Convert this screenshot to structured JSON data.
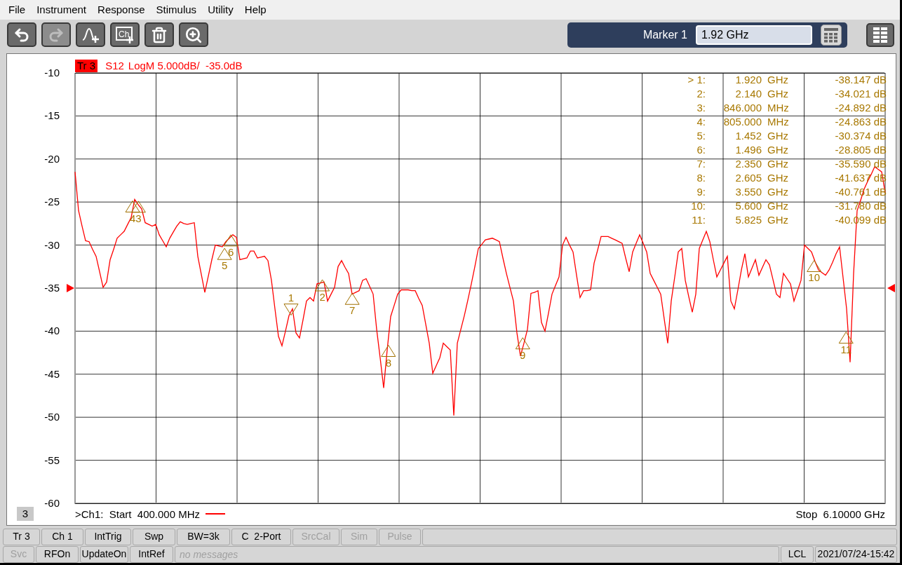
{
  "menu": [
    "File",
    "Instrument",
    "Response",
    "Stimulus",
    "Utility",
    "Help"
  ],
  "toolbar": [
    {
      "kind": "undo",
      "disabled": false
    },
    {
      "kind": "redo",
      "disabled": true
    },
    {
      "kind": "add-trace",
      "disabled": false
    },
    {
      "kind": "add-channel",
      "disabled": false,
      "text": "Ch"
    },
    {
      "kind": "delete",
      "disabled": false
    },
    {
      "kind": "zoom",
      "disabled": false
    }
  ],
  "marker_entry": {
    "label": "Marker 1",
    "value": "1.92 GHz"
  },
  "trace_header": {
    "trace": "Tr 3",
    "title": "LogM 5.000dB/  -35.0dB"
  },
  "markers_table": [
    {
      "label": "> 1:",
      "freq": "1.920",
      "unit": "GHz",
      "value": "-38.147 dB",
      "number": "1",
      "selected": true
    },
    {
      "label": "2:",
      "freq": "2.140",
      "unit": "GHz",
      "value": "-34.021 dB",
      "number": "2",
      "selected": false
    },
    {
      "label": "3:",
      "freq": "846.000",
      "unit": "MHz",
      "value": "-24.892 dB",
      "number": "3",
      "selected": false
    },
    {
      "label": "4:",
      "freq": "805.000",
      "unit": "MHz",
      "value": "-24.863 dB",
      "number": "4",
      "selected": false
    },
    {
      "label": "5:",
      "freq": "1.452",
      "unit": "GHz",
      "value": "-30.374 dB",
      "number": "5",
      "selected": false
    },
    {
      "label": "6:",
      "freq": "1.496",
      "unit": "GHz",
      "value": "-28.805 dB",
      "number": "6",
      "selected": false
    },
    {
      "label": "7:",
      "freq": "2.350",
      "unit": "GHz",
      "value": "-35.590 dB",
      "number": "7",
      "selected": false
    },
    {
      "label": "8:",
      "freq": "2.605",
      "unit": "GHz",
      "value": "-41.637 dB",
      "number": "8",
      "selected": false
    },
    {
      "label": "9:",
      "freq": "3.550",
      "unit": "GHz",
      "value": "-40.761 dB",
      "number": "9",
      "selected": false
    },
    {
      "label": "10:",
      "freq": "5.600",
      "unit": "GHz",
      "value": "-31.780 dB",
      "number": "10",
      "selected": false
    },
    {
      "label": "11:",
      "freq": "5.825",
      "unit": "GHz",
      "value": "-40.099 dB",
      "number": "11",
      "selected": false
    }
  ],
  "chart_data": {
    "type": "line",
    "ylim": [
      -60,
      -10
    ],
    "grid": true,
    "yticks": [
      -10,
      -15,
      -20,
      -25,
      -30,
      -35,
      -40,
      -45,
      -50,
      -55,
      -60
    ],
    "categories": [
      null,
      null,
      null,
      null,
      null,
      null,
      null,
      null,
      null,
      null,
      null,
      null,
      null,
      null,
      null,
      null,
      null,
      null,
      null,
      null,
      null,
      null,
      null,
      null,
      null,
      null,
      null,
      null,
      null,
      null,
      null,
      null,
      null,
      null,
      null,
      null,
      null,
      null,
      null,
      null,
      null,
      null,
      null,
      null,
      null,
      null,
      null,
      null,
      null,
      null,
      null,
      null,
      null,
      null,
      null,
      null,
      null,
      null,
      null,
      null,
      null,
      null,
      null,
      null,
      null,
      null,
      null,
      null,
      null,
      null,
      null,
      null,
      null,
      null,
      null,
      null,
      null,
      null,
      null,
      null,
      null,
      null,
      null,
      null,
      null,
      null,
      null,
      null,
      null,
      null,
      null,
      null,
      null,
      null,
      null,
      null,
      null,
      null,
      null,
      null,
      null,
      null,
      null,
      null,
      null,
      null,
      null,
      null,
      null,
      null,
      null,
      null,
      null,
      null,
      null,
      null,
      null,
      null,
      null,
      null,
      null,
      null,
      null,
      null,
      null,
      null,
      null,
      null,
      null,
      null,
      null,
      null,
      null,
      null,
      null,
      null,
      null,
      null,
      null,
      null,
      null,
      null,
      null,
      null,
      null,
      null,
      null,
      null,
      null,
      null,
      null,
      null,
      null,
      null,
      null,
      null,
      null,
      null,
      null,
      null,
      null,
      null,
      null,
      null,
      null,
      null,
      null,
      null,
      null,
      null,
      null,
      null,
      null,
      null,
      null,
      null,
      null,
      null,
      null,
      null,
      null,
      null,
      null,
      null,
      null,
      null,
      null,
      null,
      null,
      null,
      null,
      null,
      null,
      null,
      null,
      null,
      null,
      null,
      null,
      null,
      null,
      null,
      null,
      null,
      null,
      null,
      null,
      null,
      null,
      null,
      null,
      null,
      null,
      null,
      null,
      null,
      null,
      null,
      null,
      null,
      null,
      null,
      null,
      null,
      null,
      null,
      null,
      null,
      null,
      null,
      null,
      null
    ],
    "series": [
      {
        "name": "S12",
        "color": "#ff0000",
        "values": [
          -21.5,
          -26,
          -27.8,
          -29.5,
          -29.6,
          -30.5,
          -31.3,
          -33.1,
          -34.9,
          -34.3,
          -31.7,
          -30.5,
          -29.2,
          -28.8,
          -28.4,
          -27.6,
          -26.8,
          -24.7,
          -25.3,
          -25.8,
          -27.4,
          -27.6,
          -27.8,
          -27.6,
          -28.8,
          -29.5,
          -30.2,
          -29.2,
          -28.5,
          -27.8,
          -27.3,
          -27.5,
          -27.6,
          -27.5,
          -27.4,
          -31.3,
          -33.4,
          -35.5,
          -33.6,
          -31.7,
          -30,
          -30.1,
          -30.2,
          -29.6,
          -29.2,
          -28.8,
          -29.1,
          -31.7,
          -31.6,
          -31.5,
          -30.7,
          -30.7,
          -31.5,
          -31.4,
          -31.3,
          -31.8,
          -34.1,
          -37.4,
          -40.6,
          -41.7,
          -40,
          -38.2,
          -37.4,
          -40.2,
          -40.8,
          -38.7,
          -36.5,
          -36.1,
          -36.5,
          -34.5,
          -34.4,
          -34.3,
          -36.5,
          -35.7,
          -34.9,
          -32.5,
          -31.8,
          -32.6,
          -33.3,
          -35.7,
          -35.5,
          -35.3,
          -34.1,
          -33.9,
          -34.8,
          -35.7,
          -39.8,
          -43.1,
          -46.6,
          -42.2,
          -38.3,
          -37,
          -35.7,
          -35.2,
          -35.2,
          -35.2,
          -35.3,
          -35.3,
          -36.2,
          -37,
          -39.2,
          -41.4,
          -44.9,
          -44,
          -43.1,
          -41.4,
          -41.8,
          -42.2,
          -49.8,
          -41.4,
          -39.8,
          -38.2,
          -36.4,
          -34.5,
          -32.5,
          -30.4,
          -29.9,
          -29.4,
          -29.3,
          -29.2,
          -29.4,
          -29.6,
          -31.5,
          -33.3,
          -34.9,
          -36.5,
          -40.2,
          -42.9,
          -41.4,
          -39.8,
          -35.6,
          -35.5,
          -35.3,
          -39,
          -40,
          -37.9,
          -35.7,
          -34.7,
          -33.7,
          -30,
          -29.1,
          -30,
          -30.8,
          -33.5,
          -36.1,
          -35.3,
          -35.3,
          -35.2,
          -32.1,
          -30.6,
          -29,
          -29,
          -29,
          -29.2,
          -29.4,
          -29.6,
          -29.8,
          -31.5,
          -33.1,
          -30.8,
          -29.8,
          -28.8,
          -29.8,
          -30.8,
          -33.3,
          -34.1,
          -34.9,
          -35.7,
          -38.6,
          -41.4,
          -36.5,
          -33.7,
          -30.8,
          -30.4,
          -34.1,
          -36,
          -37.8,
          -35.7,
          -30.4,
          -29.4,
          -28.4,
          -29.6,
          -31.7,
          -33.7,
          -32.9,
          -32.1,
          -31.3,
          -36.5,
          -37.4,
          -35.2,
          -32.9,
          -31,
          -33.7,
          -32.7,
          -31.7,
          -33.5,
          -32.6,
          -31.7,
          -32.3,
          -34,
          -35.7,
          -36.1,
          -33.3,
          -33.9,
          -34.5,
          -36.5,
          -35.3,
          -34.1,
          -30,
          -30.4,
          -30.8,
          -31.9,
          -32.9,
          -33.2,
          -33.5,
          -32.9,
          -32,
          -31,
          -30.2,
          -33.8,
          -37.4,
          -43.6,
          -33.3,
          -26,
          -24.8,
          -23.5,
          -22.6,
          -21.8,
          -20.9,
          -21.2,
          -21.5,
          -23.9
        ]
      }
    ]
  },
  "footer": {
    "window_number": "3",
    "start": ">Ch1:  Start  400.000 MHz",
    "stop": "Stop  6.10000 GHz"
  },
  "status_row_1": [
    {
      "text": "Tr 3",
      "disabled": false
    },
    {
      "text": "Ch 1",
      "disabled": false
    },
    {
      "text": "IntTrig",
      "disabled": false
    },
    {
      "text": "Swp",
      "disabled": false
    },
    {
      "text": "BW=3k",
      "disabled": false
    },
    {
      "text": "C  2-Port",
      "disabled": false
    },
    {
      "text": "SrcCal",
      "disabled": true
    },
    {
      "text": "Sim",
      "disabled": true
    },
    {
      "text": "Pulse",
      "disabled": true
    }
  ],
  "status_row_2": [
    {
      "text": "Svc",
      "disabled": true
    },
    {
      "text": "RFOn",
      "disabled": false
    },
    {
      "text": "UpdateOn",
      "disabled": false
    },
    {
      "text": "IntRef",
      "disabled": false
    }
  ],
  "message": {
    "placeholder": "no messages"
  },
  "status_right": [
    "LCL",
    "2021/07/24-15:42"
  ]
}
